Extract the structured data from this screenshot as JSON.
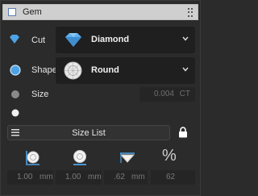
{
  "panel": {
    "title": "Gem"
  },
  "rows": {
    "cut": {
      "label": "Cut",
      "value": "Diamond"
    },
    "shape": {
      "label": "Shape",
      "value": "Round"
    },
    "size": {
      "label": "Size",
      "value": "0.004",
      "unit": "CT"
    }
  },
  "size_list": {
    "label": "Size List"
  },
  "params": [
    {
      "icon": "diameter-icon",
      "value": "1.00",
      "unit": "mm"
    },
    {
      "icon": "girdle-icon",
      "value": "1.00",
      "unit": "mm"
    },
    {
      "icon": "depth-icon",
      "value": ".62",
      "unit": "mm"
    },
    {
      "icon": "percent-icon",
      "symbol": "%",
      "value": "62",
      "unit": ""
    }
  ],
  "colors": {
    "accent": "#4da3e6",
    "header_bg": "#cfcfcf",
    "panel_bg": "#2b2b2b",
    "field_bg": "#1f1f1f"
  }
}
